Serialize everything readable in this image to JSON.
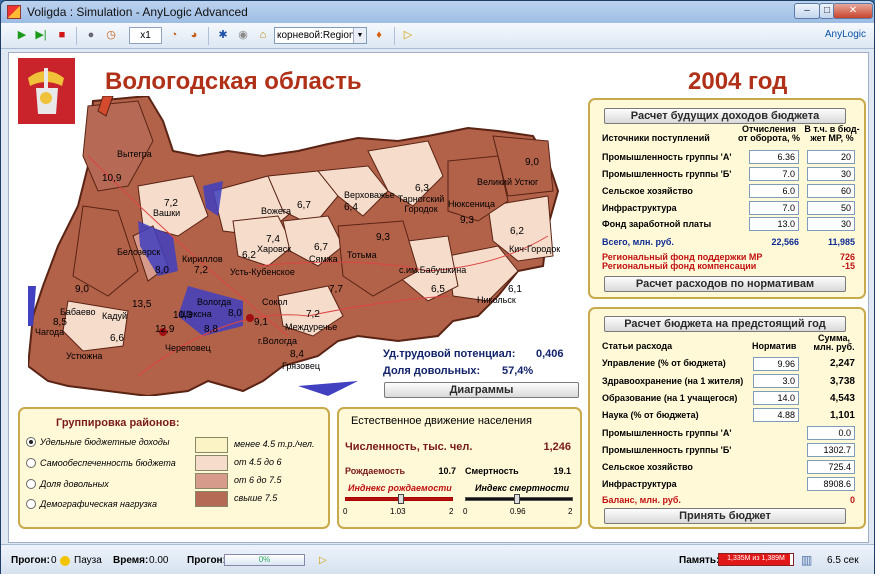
{
  "window": {
    "title": "Voligda : Simulation - AnyLogic Advanced",
    "minimize": "–",
    "maximize": "□",
    "close": "✕"
  },
  "toolbar": {
    "speed": "x1",
    "view_select": "корневой:Region",
    "brand": "AnyLogic"
  },
  "header": {
    "region_title": "Вологодская область",
    "year": "2004 год"
  },
  "map": {
    "districts": [
      {
        "name": "Вытегра",
        "value": "10,9"
      },
      {
        "name": "Вашки",
        "value": "7,2"
      },
      {
        "name": "Белозерск",
        "value": "8,0"
      },
      {
        "name": "Кириллов",
        "value": "7,2"
      },
      {
        "name": "Бабаево",
        "value": "9,0"
      },
      {
        "name": "Чагода",
        "value": "8,5"
      },
      {
        "name": "Кадуй",
        "value": "13,5"
      },
      {
        "name": "Устюжна",
        "value": "6,6"
      },
      {
        "name": "Череповец",
        "value": "12,9"
      },
      {
        "name": "Шексна",
        "value": "10,3"
      },
      {
        "name": "Усть-Кубенское",
        "value": "6,2"
      },
      {
        "name": "Харовск",
        "value": "7,4"
      },
      {
        "name": "Вожега",
        "value": "6,7"
      },
      {
        "name": "Верховажье",
        "value": "6,4"
      },
      {
        "name": "Сямжа",
        "value": "6,7"
      },
      {
        "name": "Тотьма",
        "value": "9,3"
      },
      {
        "name": "Тарногский Городок",
        "value": "6,3"
      },
      {
        "name": "Нюксеница",
        "value": "9,3"
      },
      {
        "name": "Великий Устюг",
        "value": "9,0"
      },
      {
        "name": "Кич-Городок",
        "value": "6,2"
      },
      {
        "name": "Никольск",
        "value": "6,1"
      },
      {
        "name": "с.им.Бабушкина",
        "value": "6,5"
      },
      {
        "name": "Сокол",
        "value": "7,7"
      },
      {
        "name": "Междуречье",
        "value": "7,2"
      },
      {
        "name": "г.Вологда",
        "value": "9,1"
      },
      {
        "name": "Грязовец",
        "value": "8,4"
      },
      {
        "name": "Вологда",
        "value": "8,0"
      },
      {
        "name": "",
        "value": "8,8"
      }
    ],
    "labor_potential_label": "Уд.трудовой потенциал:",
    "labor_potential_value": "0,406",
    "satisfied_label": "Доля довольных:",
    "satisfied_value": "57,4%",
    "diagrams_button": "Диаграммы"
  },
  "income": {
    "title_button": "Расчет будущих доходов бюджета",
    "col_source": "Источники поступлений",
    "col_rate": "Отчисления от оборота, %",
    "col_mr": "В т.ч. в бюд- жет МР, %",
    "rows": [
      {
        "label": "Промышленность группы 'А'",
        "rate": "6.36",
        "mr": "20"
      },
      {
        "label": "Промышленность группы 'Б'",
        "rate": "7.0",
        "mr": "30"
      },
      {
        "label": "Сельское хозяйство",
        "rate": "6.0",
        "mr": "60"
      },
      {
        "label": "Инфраструктура",
        "rate": "7.0",
        "mr": "50"
      },
      {
        "label": "Фонд заработной платы",
        "rate": "13.0",
        "mr": "30"
      }
    ],
    "total_label": "Всего, млн. руб.",
    "total_value": "22,566",
    "total_mr": "11,985",
    "fund1_label": "Региональный фонд поддержки МР",
    "fund1_value": "726",
    "fund2_label": "Региональный фонд компенсации",
    "fund2_value": "-15",
    "norms_button": "Расчет расходов по нормативам"
  },
  "budget": {
    "title_button": "Расчет бюджета на предстоящий год",
    "col_item": "Статьи расхода",
    "col_norm": "Норматив",
    "col_sum": "Сумма, млн. руб.",
    "rows": [
      {
        "label": "Управление (% от бюджета)",
        "norm": "9.96",
        "sum": "2,247"
      },
      {
        "label": "Здравоохранение (на 1 жителя)",
        "norm": "3.0",
        "sum": "3,738"
      },
      {
        "label": "Образование (на 1 учащегося)",
        "norm": "14.0",
        "sum": "4,543"
      },
      {
        "label": "Наука (% от бюджета)",
        "norm": "4.88",
        "sum": "1,101"
      }
    ],
    "sectors": [
      {
        "label": "Промышленность группы 'А'",
        "value": "0.0"
      },
      {
        "label": "Промышленность группы 'Б'",
        "value": "1302.7"
      },
      {
        "label": "Сельское хозяйство",
        "value": "725.4"
      },
      {
        "label": "Инфраструктура",
        "value": "8908.6"
      }
    ],
    "balance_label": "Баланс, млн. руб.",
    "balance_value": "0",
    "accept_button": "Принять бюджет"
  },
  "grouping": {
    "title": "Группировка районов:",
    "options": [
      "Удельные бюджетные доходы",
      "Самообеспеченность бюджета",
      "Доля довольных",
      "Демографическая нагрузка"
    ],
    "selected": 0,
    "legend": [
      {
        "label": "менее 4.5 т.р./чел.",
        "color": "#fbf3c6"
      },
      {
        "label": "от 4.5 до 6",
        "color": "#f6dccb"
      },
      {
        "label": "от 6 до 7.5",
        "color": "#d79b8b"
      },
      {
        "label": "свыше 7.5",
        "color": "#b46a55"
      }
    ]
  },
  "population": {
    "title": "Естественное движение населения",
    "count_label": "Численность, тыс. чел.",
    "count_value": "1,246",
    "birth_label": "Рождаемость",
    "birth_value": "10.7",
    "death_label": "Смертность",
    "death_value": "19.1",
    "birth_index_label": "Инднекс рождаемости",
    "birth_index_min": "0",
    "birth_index_val": "1.03",
    "birth_index_max": "2",
    "birth_index_level": 0.515,
    "death_index_label": "Индекс смертности",
    "death_index_min": "0",
    "death_index_val": "0.96",
    "death_index_max": "2",
    "death_index_level": 0.48
  },
  "statusbar": {
    "run_label": "Прогон:",
    "run_value": "0",
    "pause_label": "Пауза",
    "time_label": "Время:",
    "time_value": "0.00",
    "progress_label": "Прогон:",
    "progress_value": "0%",
    "memory_label": "Память:",
    "memory_value": "1,335M из 1,389M",
    "memory_fraction": 0.96,
    "elapsed": "6.5 сек"
  }
}
